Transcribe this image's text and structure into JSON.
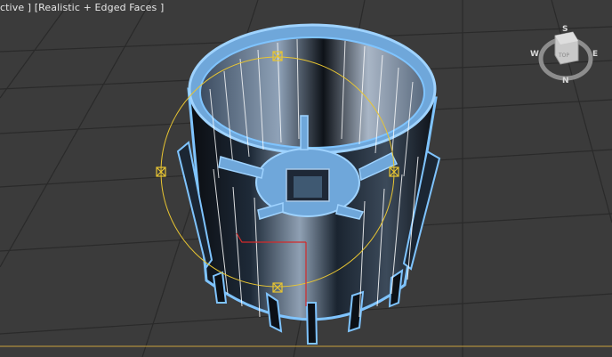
{
  "viewport": {
    "label": "ctive ] [Realistic + Edged Faces ]",
    "label_text": "ctive ] [Realistic + Edged Faces ]"
  },
  "viewcube": {
    "face_label": "TOP",
    "compass": {
      "north": "N",
      "south": "S",
      "east": "E",
      "west": "W"
    }
  },
  "colors": {
    "background": "#3b3b3b",
    "grid": "#2a2a2a",
    "selection_outline": "#7fc4ff",
    "gizmo": "#e8c532",
    "axis_x": "#d42a2a",
    "horizon": "#c9a23c"
  },
  "icons": [
    "viewcube-icon",
    "transform-gizmo-icon",
    "pivot-axis-icon"
  ]
}
